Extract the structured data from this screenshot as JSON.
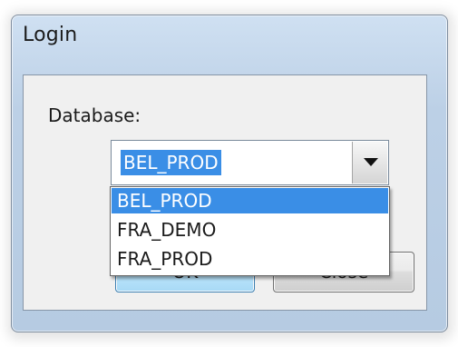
{
  "dialog": {
    "title": "Login",
    "database_label": "Database:",
    "database_combo": {
      "value": "BEL_PROD",
      "options": [
        "BEL_PROD",
        "FRA_DEMO",
        "FRA_PROD"
      ],
      "selected_index": 0,
      "expanded": true
    },
    "ok_label": "OK",
    "close_label": "Close"
  },
  "colors": {
    "selection": "#3a8ee6",
    "window_frame": "#bcd0e6",
    "client_area": "#f0f0f0"
  },
  "icons": {
    "combo_button": "chevron-down-icon"
  }
}
